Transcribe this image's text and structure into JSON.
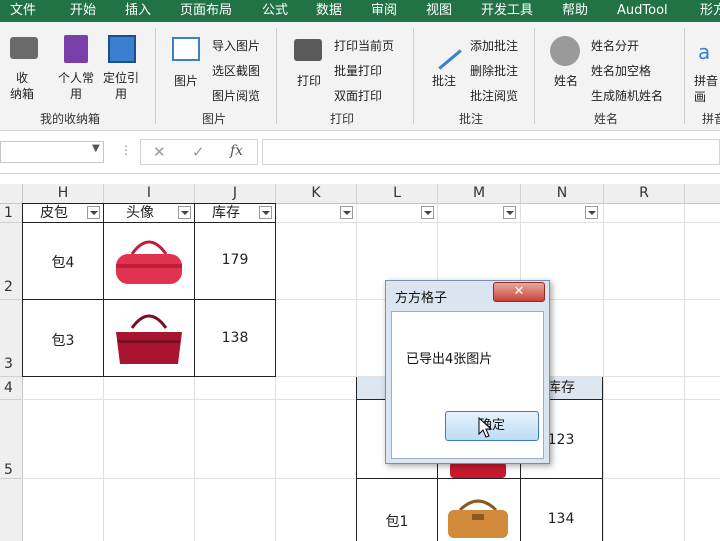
{
  "ribbon_tabs": [
    "文件",
    "开始",
    "插入",
    "页面布局",
    "公式",
    "数据",
    "审阅",
    "视图",
    "开发工具",
    "帮助",
    "AudTool",
    "形方"
  ],
  "ribbon": {
    "group1": {
      "btn_box": "收\n纳箱",
      "btn_personal": "个人常\n用",
      "btn_locate": "定位引\n用",
      "label": "我的收纳箱"
    },
    "group2": {
      "btn_image": "图片",
      "items": [
        "导入图片",
        "选区截图",
        "图片阅览"
      ],
      "label": "图片"
    },
    "group3": {
      "btn_print": "打印",
      "items": [
        "打印当前页",
        "批量打印",
        "双面打印"
      ],
      "label": "打印"
    },
    "group4": {
      "btn_comment": "批注",
      "items": [
        "添加批注",
        "删除批注",
        "批注阅览"
      ],
      "label": "批注"
    },
    "group5": {
      "btn_name": "姓名",
      "items": [
        "姓名分开",
        "姓名加空格",
        "生成随机姓名"
      ],
      "label": "姓名"
    },
    "group6": {
      "btn_pinyin": "拼音",
      "sub": "画",
      "label": "拼音"
    }
  },
  "formula_bar": {
    "name_box": "",
    "cancel": "✕",
    "enter": "✓",
    "fx": "fx",
    "value": ""
  },
  "columns": [
    "H",
    "I",
    "J",
    "K",
    "L",
    "M",
    "N",
    "R"
  ],
  "rows": [
    "1",
    "2",
    "3",
    "4",
    "5"
  ],
  "table_top": {
    "headers": [
      "皮包",
      "头像",
      "库存"
    ],
    "rows": [
      [
        "包4",
        "",
        "179"
      ],
      [
        "包3",
        "",
        "138"
      ]
    ]
  },
  "table_bottom": {
    "header_visible": "库存",
    "cells": [
      [
        "",
        "",
        "123"
      ],
      [
        "包1",
        "",
        "134"
      ]
    ]
  },
  "dialog": {
    "title": "方方格子",
    "message": "已导出4张图片",
    "ok": "确定",
    "close": "✕"
  }
}
